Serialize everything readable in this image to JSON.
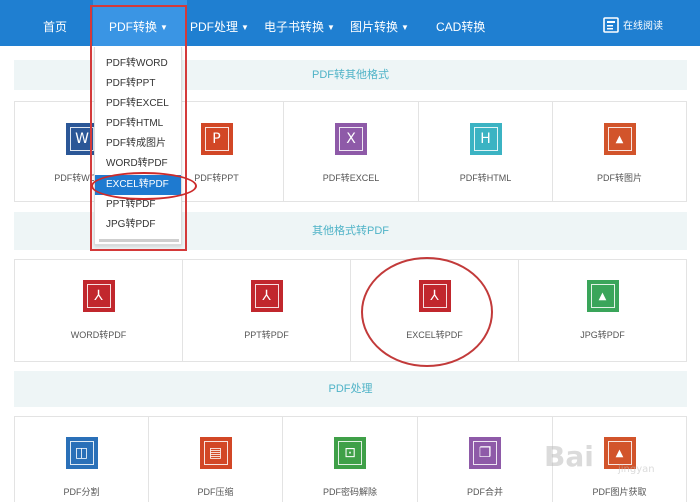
{
  "nav": {
    "home": "首页",
    "pdf_convert": "PDF转换",
    "pdf_process": "PDF处理",
    "ebook_convert": "电子书转换",
    "image_convert": "图片转换",
    "cad_convert": "CAD转换",
    "online_read": "在线阅读"
  },
  "dropdown": {
    "items": [
      "PDF转WORD",
      "PDF转PPT",
      "PDF转EXCEL",
      "PDF转HTML",
      "PDF转成图片",
      "WORD转PDF",
      "EXCEL转PDF",
      "PPT转PDF",
      "JPG转PDF"
    ],
    "selected": "EXCEL转PDF"
  },
  "sections": [
    {
      "title": "PDF转其他格式",
      "items": [
        {
          "label": "PDF转WORD",
          "icon": "word-icon",
          "color": "#2b5797",
          "glyph": "W"
        },
        {
          "label": "PDF转PPT",
          "icon": "ppt-icon",
          "color": "#d24726",
          "glyph": "P"
        },
        {
          "label": "PDF转EXCEL",
          "icon": "excel-icon",
          "color": "#8e5aa8",
          "glyph": "X"
        },
        {
          "label": "PDF转HTML",
          "icon": "html-icon",
          "color": "#3bb3c3",
          "glyph": "H"
        },
        {
          "label": "PDF转图片",
          "icon": "image-icon",
          "color": "#d2542b",
          "glyph": "▲"
        }
      ]
    },
    {
      "title": "其他格式转PDF",
      "items": [
        {
          "label": "WORD转PDF",
          "icon": "pdf-icon",
          "color": "#c1272d",
          "glyph": "⅄"
        },
        {
          "label": "PPT转PDF",
          "icon": "pdf-icon",
          "color": "#c1272d",
          "glyph": "⅄"
        },
        {
          "label": "EXCEL转PDF",
          "icon": "pdf-icon",
          "color": "#c1272d",
          "glyph": "⅄"
        },
        {
          "label": "JPG转PDF",
          "icon": "jpg-icon",
          "color": "#3aa55a",
          "glyph": "▲"
        }
      ]
    },
    {
      "title": "PDF处理",
      "items": [
        {
          "label": "PDF分割",
          "icon": "split-icon",
          "color": "#2a70b8",
          "glyph": "◫"
        },
        {
          "label": "PDF压缩",
          "icon": "compress-icon",
          "color": "#d24726",
          "glyph": "▤"
        },
        {
          "label": "PDF密码解除",
          "icon": "unlock-icon",
          "color": "#3fa048",
          "glyph": "⊡"
        },
        {
          "label": "PDF合并",
          "icon": "merge-icon",
          "color": "#8e5aa8",
          "glyph": "❐"
        },
        {
          "label": "PDF图片获取",
          "icon": "image-extract-icon",
          "color": "#d2542b",
          "glyph": "▲"
        }
      ]
    }
  ],
  "watermark": {
    "text": "Bai",
    "sub": "jingyan"
  }
}
